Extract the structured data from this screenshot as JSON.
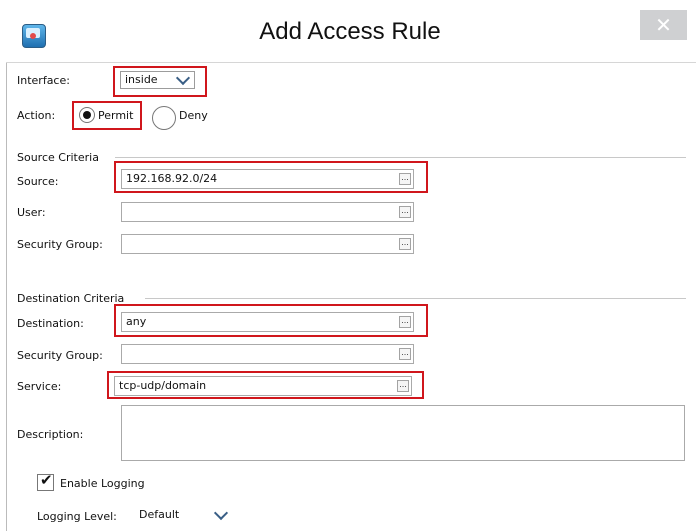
{
  "window": {
    "title": "Add Access Rule",
    "close_label": "✕"
  },
  "interface": {
    "label": "Interface:",
    "value": "inside"
  },
  "action": {
    "label": "Action:",
    "permit_label": "Permit",
    "deny_label": "Deny",
    "selected": "Permit"
  },
  "source_criteria": {
    "heading": "Source Criteria",
    "source_label": "Source:",
    "source_value": "192.168.92.0/24",
    "user_label": "User:",
    "user_value": "",
    "security_group_label": "Security Group:",
    "security_group_value": ""
  },
  "destination_criteria": {
    "heading": "Destination Criteria",
    "destination_label": "Destination:",
    "destination_value": "any",
    "security_group_label": "Security Group:",
    "security_group_value": "",
    "service_label": "Service:",
    "service_value": "tcp-udp/domain"
  },
  "description": {
    "label": "Description:",
    "value": ""
  },
  "logging": {
    "enable_label": "Enable Logging",
    "enabled": true,
    "level_label": "Logging Level:",
    "level_value": "Default"
  },
  "browse_glyph": "...",
  "colors": {
    "highlight": "#d0161c",
    "close_button": "#cfd0d2"
  }
}
